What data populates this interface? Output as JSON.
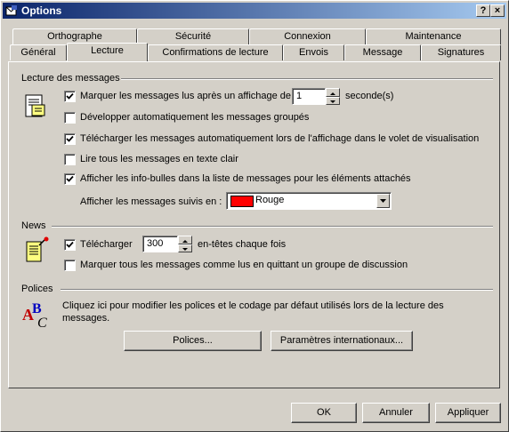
{
  "window": {
    "title": "Options",
    "help_btn": "?",
    "close_btn": "×"
  },
  "tabs_back": [
    "Orthographe",
    "Sécurité",
    "Connexion",
    "Maintenance"
  ],
  "tabs_front": [
    "Général",
    "Lecture",
    "Confirmations de lecture",
    "Envois",
    "Message",
    "Signatures"
  ],
  "active_tab": "Lecture",
  "lecture": {
    "title": "Lecture des messages",
    "mark_read_label": "Marquer les messages lus après un affichage de",
    "mark_read_value": "1",
    "mark_read_unit": "seconde(s)",
    "expand_groups_label": "Développer automatiquement les messages groupés",
    "download_auto_label": "Télécharger les messages automatiquement lors de l'affichage dans le volet de visualisation",
    "plain_text_label": "Lire tous les messages en texte clair",
    "tooltips_label": "Afficher les info-bulles dans la liste de messages pour les éléments attachés",
    "followed_label": "Afficher les messages suivis en :",
    "followed_value": "Rouge",
    "followed_color": "#ff0000"
  },
  "checks": {
    "mark_read": true,
    "expand_groups": false,
    "download_auto": true,
    "plain_text": false,
    "tooltips": true,
    "news_download": true,
    "news_mark_read": false
  },
  "news": {
    "title": "News",
    "download_label": "Télécharger",
    "download_value": "300",
    "headers_label": "en-têtes chaque fois",
    "mark_read_label": "Marquer tous les messages comme lus en quittant un groupe de discussion"
  },
  "fonts": {
    "title": "Polices",
    "description": "Cliquez ici pour modifier les polices et le codage par défaut utilisés lors de la lecture des messages.",
    "fonts_button": "Polices...",
    "intl_button": "Paramètres internationaux..."
  },
  "footer": {
    "ok": "OK",
    "cancel": "Annuler",
    "apply": "Appliquer"
  }
}
